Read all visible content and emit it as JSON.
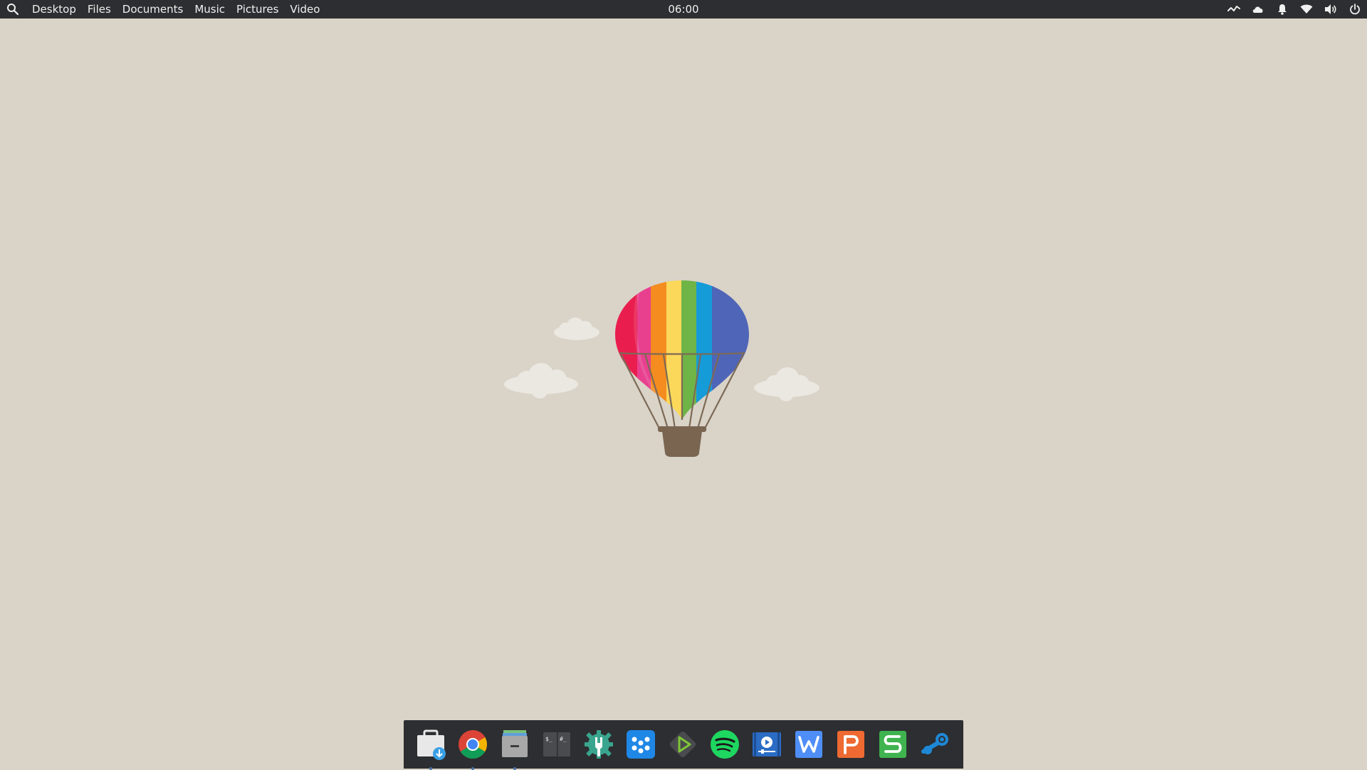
{
  "topbar": {
    "menu": [
      "Desktop",
      "Files",
      "Documents",
      "Music",
      "Pictures",
      "Video"
    ],
    "clock": "06:00"
  },
  "tray": {
    "icons": [
      "network-activity-icon",
      "cloud-icon",
      "notification-bell-icon",
      "wifi-icon",
      "volume-icon",
      "power-icon"
    ]
  },
  "dock": {
    "apps": [
      {
        "name": "software-center",
        "running": true
      },
      {
        "name": "chrome",
        "running": true
      },
      {
        "name": "file-manager",
        "running": true
      },
      {
        "name": "terminal",
        "running": false
      },
      {
        "name": "system-settings",
        "running": false
      },
      {
        "name": "app-launcher",
        "running": false
      },
      {
        "name": "media-player",
        "running": false
      },
      {
        "name": "spotify",
        "running": false
      },
      {
        "name": "video-editor",
        "running": false
      },
      {
        "name": "wps-writer",
        "running": false
      },
      {
        "name": "wps-presentation",
        "running": false
      },
      {
        "name": "wps-spreadsheet",
        "running": false
      },
      {
        "name": "steam",
        "running": false
      }
    ]
  },
  "colors": {
    "desktop_bg": "#d9d3c8",
    "panel_bg": "#2d2e31"
  }
}
